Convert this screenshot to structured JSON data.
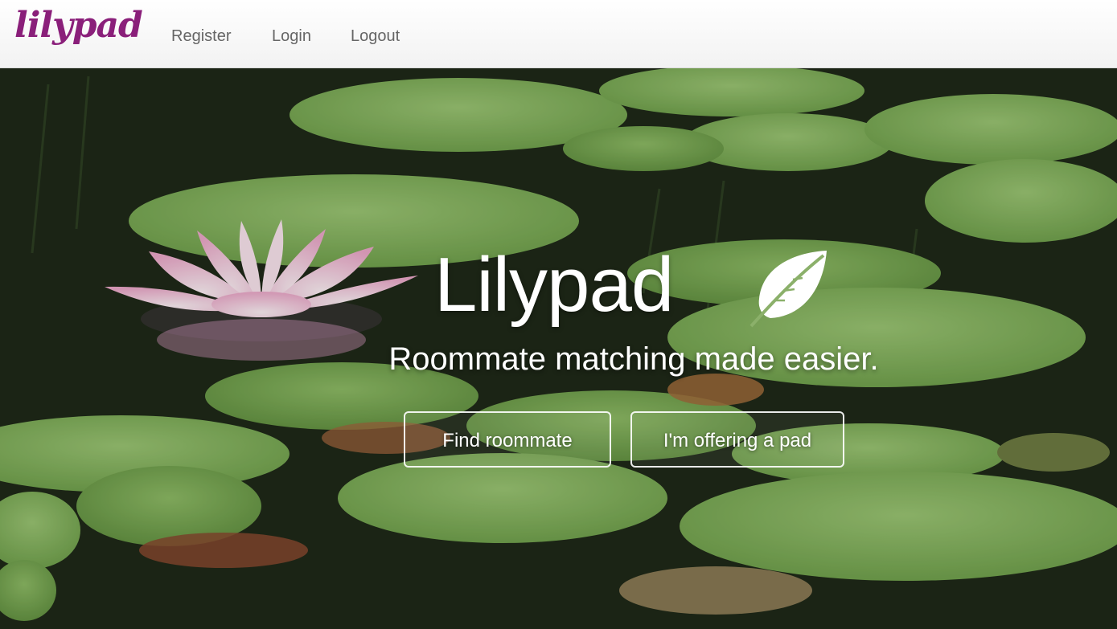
{
  "navbar": {
    "brand": "lilypad",
    "links": [
      {
        "label": "Register"
      },
      {
        "label": "Login"
      },
      {
        "label": "Logout"
      }
    ]
  },
  "hero": {
    "title": "Lilypad",
    "subtitle": "Roommate matching made easier.",
    "buttons": {
      "find_roommate": "Find roommate",
      "offering_pad": "I'm offering a pad"
    },
    "icon": "leaf-icon",
    "background": "water-lily-pond-photo"
  },
  "colors": {
    "brand": "#8a1f7a",
    "nav_text": "#666666",
    "hero_text": "#ffffff",
    "lily_pad": "#7fb05a",
    "water": "#1d2818",
    "flower": "#f4c6dc"
  }
}
